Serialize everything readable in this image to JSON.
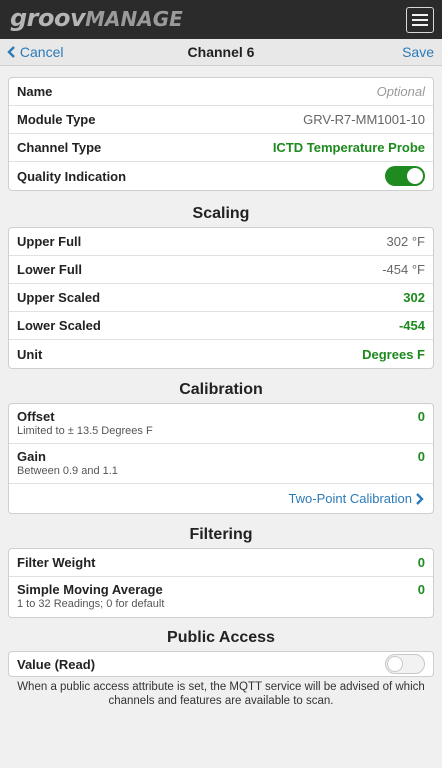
{
  "app": {
    "logo_main": "groov",
    "logo_sub": "MANAGE",
    "menu_icon": "hamburger-icon"
  },
  "nav": {
    "cancel_label": "Cancel",
    "title": "Channel 6",
    "save_label": "Save"
  },
  "general": {
    "name_label": "Name",
    "name_placeholder": "Optional",
    "module_type_label": "Module Type",
    "module_type_value": "GRV-R7-MM1001-10",
    "channel_type_label": "Channel Type",
    "channel_type_value": "ICTD Temperature Probe",
    "quality_label": "Quality Indication",
    "quality_on": true
  },
  "scaling": {
    "title": "Scaling",
    "rows": [
      {
        "label": "Upper Full",
        "value": "302 °F"
      },
      {
        "label": "Lower Full",
        "value": "-454 °F"
      },
      {
        "label": "Upper Scaled",
        "value": "302"
      },
      {
        "label": "Lower Scaled",
        "value": "-454"
      },
      {
        "label": "Unit",
        "value": "Degrees F"
      }
    ]
  },
  "calibration": {
    "title": "Calibration",
    "offset_label": "Offset",
    "offset_hint": "Limited to ± 13.5 Degrees F",
    "offset_value": "0",
    "gain_label": "Gain",
    "gain_hint": "Between 0.9 and 1.1",
    "gain_value": "0",
    "two_point_label": "Two-Point Calibration"
  },
  "filtering": {
    "title": "Filtering",
    "weight_label": "Filter Weight",
    "weight_value": "0",
    "sma_label": "Simple Moving Average",
    "sma_hint": "1 to 32 Readings; 0 for default",
    "sma_value": "0"
  },
  "public_access": {
    "title": "Public Access",
    "value_read_label": "Value (Read)",
    "value_read_on": false,
    "note": "When a public access attribute is set, the MQTT service will be advised of which channels and features are available to scan."
  },
  "colors": {
    "accent": "#2b7bb9",
    "green": "#1c8a1c",
    "header": "#2b2b2b"
  }
}
